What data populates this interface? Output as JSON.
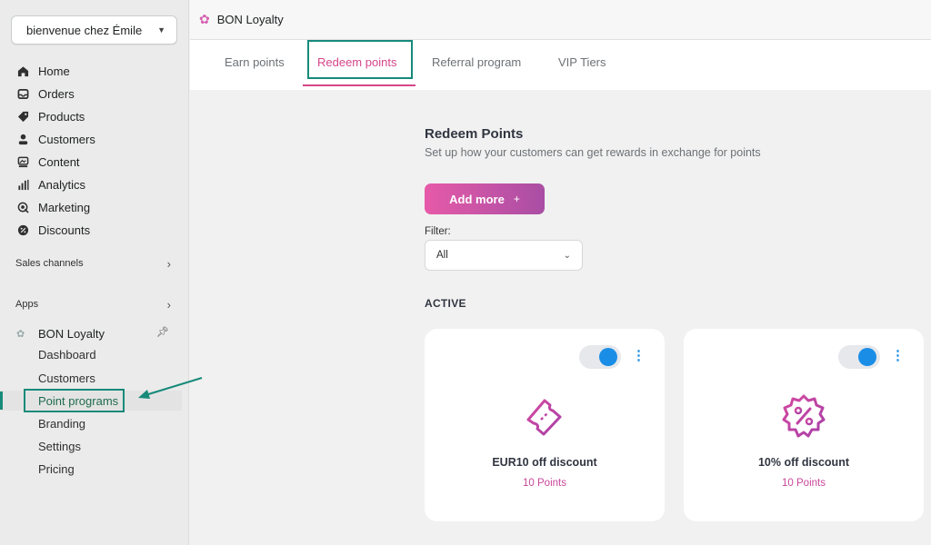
{
  "sidebar": {
    "store_name": "bienvenue chez Émile",
    "items": [
      {
        "label": "Home"
      },
      {
        "label": "Orders"
      },
      {
        "label": "Products"
      },
      {
        "label": "Customers"
      },
      {
        "label": "Content"
      },
      {
        "label": "Analytics"
      },
      {
        "label": "Marketing"
      },
      {
        "label": "Discounts"
      }
    ],
    "sales_channels": "Sales channels",
    "apps": "Apps",
    "app_name": "BON Loyalty",
    "app_subitems": [
      {
        "label": "Dashboard"
      },
      {
        "label": "Customers"
      },
      {
        "label": "Point programs"
      },
      {
        "label": "Branding"
      },
      {
        "label": "Settings"
      },
      {
        "label": "Pricing"
      }
    ]
  },
  "topbar": {
    "title": "BON Loyalty"
  },
  "tabs": [
    {
      "label": "Earn points"
    },
    {
      "label": "Redeem points"
    },
    {
      "label": "Referral program"
    },
    {
      "label": "VIP Tiers"
    }
  ],
  "main": {
    "title": "Redeem Points",
    "subtitle": "Set up how your customers can get rewards in exchange for points",
    "add_button": "Add more",
    "add_button_plus": "+",
    "filter_label": "Filter:",
    "filter_value": "All",
    "section_active": "ACTIVE",
    "cards": [
      {
        "title": "EUR10 off discount",
        "points": "10 Points",
        "icon": "ticket-icon",
        "enabled": true
      },
      {
        "title": "10% off discount",
        "points": "10 Points",
        "icon": "percent-badge-icon",
        "enabled": true
      }
    ]
  },
  "colors": {
    "accent_pink": "#d5468a",
    "toggle_blue": "#1a8ee6",
    "highlight_teal": "#178a7a"
  }
}
